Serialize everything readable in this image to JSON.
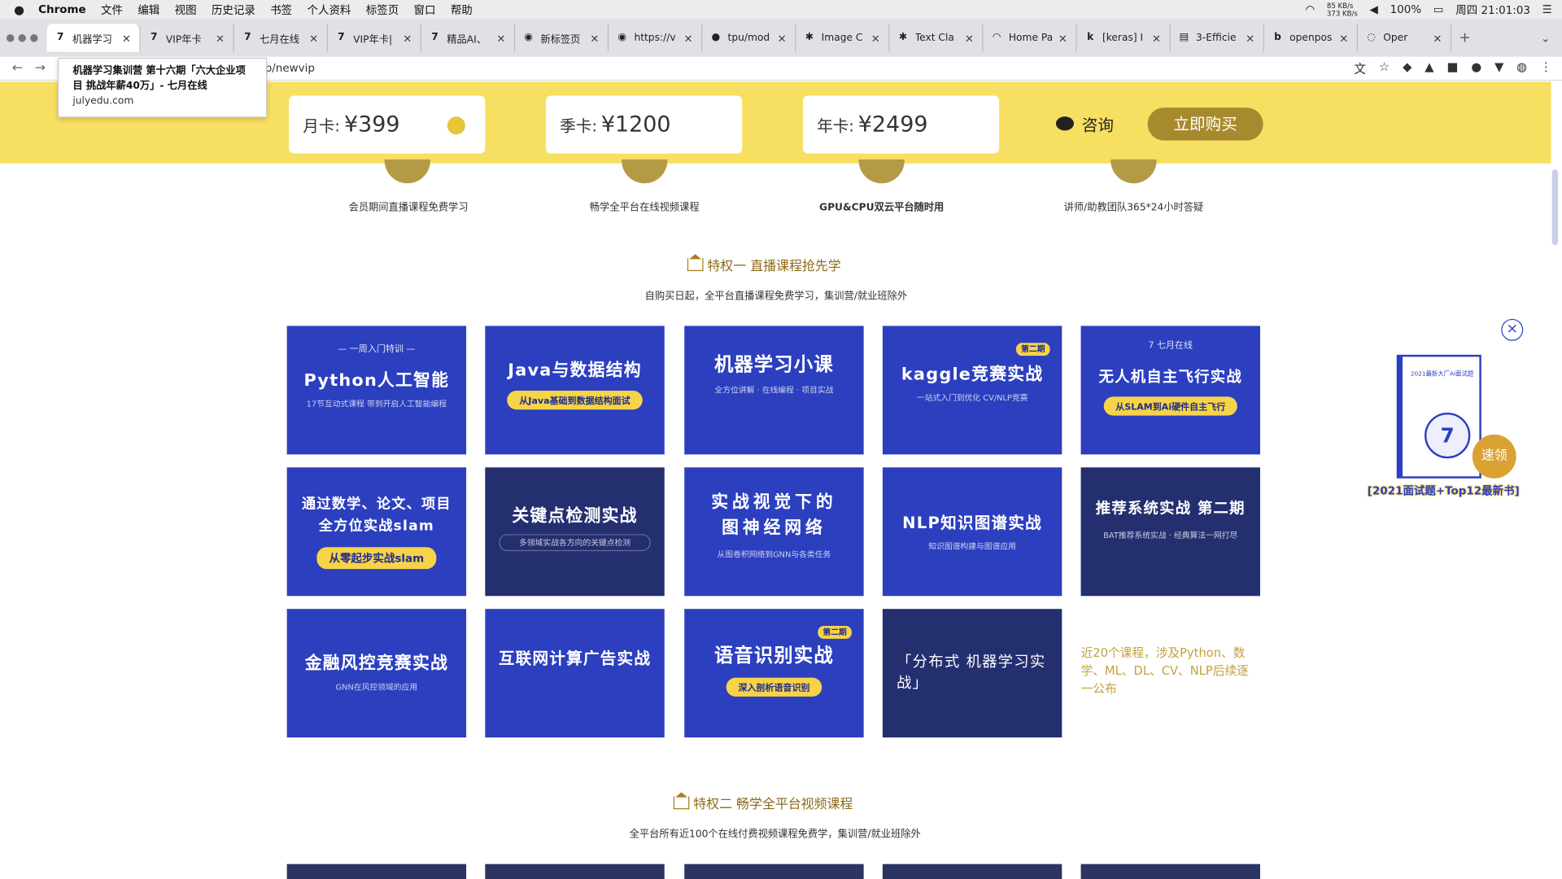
{
  "menubar": {
    "app": "Chrome",
    "items": [
      "文件",
      "编辑",
      "视图",
      "历史记录",
      "书签",
      "个人资料",
      "标签页",
      "窗口",
      "帮助"
    ],
    "net_up": "85 KB/s",
    "net_down": "373 KB/s",
    "battery": "100%",
    "clock": "周四 21:01:03"
  },
  "tabs": [
    {
      "label": "机器学习",
      "icon": "t"
    },
    {
      "label": "VIP年卡",
      "icon": "t"
    },
    {
      "label": "七月在线",
      "icon": "t"
    },
    {
      "label": "VIP年卡|",
      "icon": "t"
    },
    {
      "label": "精品AI、",
      "icon": "t"
    },
    {
      "label": "新标签页",
      "icon": "o"
    },
    {
      "label": "https://v",
      "icon": "o"
    },
    {
      "label": "tpu/mod",
      "icon": "g"
    },
    {
      "label": "Image C",
      "icon": "k"
    },
    {
      "label": "Text Cla",
      "icon": "k"
    },
    {
      "label": "Home Pa",
      "icon": "h"
    },
    {
      "label": "[keras] I",
      "icon": "k"
    },
    {
      "label": "3-Efficie",
      "icon": "c"
    },
    {
      "label": "openpos",
      "icon": "b"
    },
    {
      "label": "Oper",
      "icon": "o"
    }
  ],
  "address": {
    "url": "p/newvip"
  },
  "tooltip": {
    "title": "机器学习集训营 第十六期「六大企业项目 挑战年薪40万」- 七月在线",
    "url": "julyedu.com"
  },
  "plans": [
    {
      "label": "月卡:",
      "price": "¥399"
    },
    {
      "label": "季卡:",
      "price": "¥1200"
    },
    {
      "label": "年卡:",
      "price": "¥2499"
    }
  ],
  "consult_label": "咨询",
  "buy_label": "立即购买",
  "perks": [
    "会员期间直播课程免费学习",
    "畅学全平台在线视频课程",
    "GPU&CPU双云平台随时用",
    "讲师/助教团队365*24小时答疑"
  ],
  "section1": {
    "title": "特权一 直播课程抢先学",
    "subtitle": "自购买日起，全平台直播课程免费学习，集训营/就业班除外"
  },
  "courses": [
    {
      "title": "Python人工智能",
      "sub": "17节互动式课程 带到开启人工智能编程",
      "logo": "— 一周入门特训 —",
      "pill": "",
      "badge": ""
    },
    {
      "title": "Java与数据结构",
      "sub": "",
      "logo": "",
      "pill": "从Java基础到数据结构面试",
      "badge": ""
    },
    {
      "title": "机器学习小课",
      "sub": "全方位讲解 · 在线编程 · 项目实战",
      "logo": "",
      "pill": "",
      "badge": ""
    },
    {
      "title": "kaggle竞赛实战",
      "sub": "一站式入门到优化 CV/NLP竞赛",
      "logo": "",
      "pill": "",
      "badge": "第二期"
    },
    {
      "title": "无人机自主飞行实战",
      "sub": "",
      "logo": "7 七月在线",
      "pill": "从SLAM到Ai硬件自主飞行",
      "badge": ""
    },
    {
      "title": "通过数学、论文、项目 全方位实战slam",
      "sub": "",
      "logo": "",
      "pill": "从零起步实战slam",
      "badge": ""
    },
    {
      "title": "关键点检测实战",
      "sub": "多领域实战各方向的关键点检测",
      "logo": "",
      "pill": "",
      "badge": ""
    },
    {
      "title": "实战视觉下的图神经网络",
      "sub": "从图卷积网络到GNN与各类任务",
      "logo": "",
      "pill": "",
      "badge": ""
    },
    {
      "title": "NLP知识图谱实战",
      "sub": "知识图谱构建与图谱应用",
      "logo": "",
      "pill": "",
      "badge": ""
    },
    {
      "title": "推荐系统实战 第二期",
      "sub": "BAT推荐系统实战 · 经典算法一网打尽",
      "logo": "",
      "pill": "",
      "badge": ""
    },
    {
      "title": "金融风控竞赛实战",
      "sub": "GNN在风控领域的应用",
      "logo": "",
      "pill": "",
      "badge": ""
    },
    {
      "title": "互联网计算广告实战",
      "sub": "",
      "logo": "",
      "pill": "",
      "badge": ""
    },
    {
      "title": "语音识别实战",
      "sub": "",
      "logo": "",
      "pill": "深入剖析语音识别",
      "badge": "第二期"
    },
    {
      "title": "「分布式 机器学习实战」",
      "sub": "",
      "logo": "",
      "pill": "",
      "badge": ""
    }
  ],
  "courses_more": "近20个课程，涉及Python、数学、ML、DL、CV、NLP后续逐一公布",
  "section2": {
    "title": "特权二 畅学全平台视频课程",
    "subtitle": "全平台所有近100个在线付费视频课程免费学，集训营/就业班除外"
  },
  "float_ad": {
    "book_title": "2021最新大厂AI面试题",
    "button": "速领",
    "caption": "[2021面试题+Top12最新书]"
  },
  "colors": {
    "yellow": "#f7df62",
    "royal": "#2b3fbf",
    "navy": "#242f70",
    "gold": "#a88a2e"
  }
}
